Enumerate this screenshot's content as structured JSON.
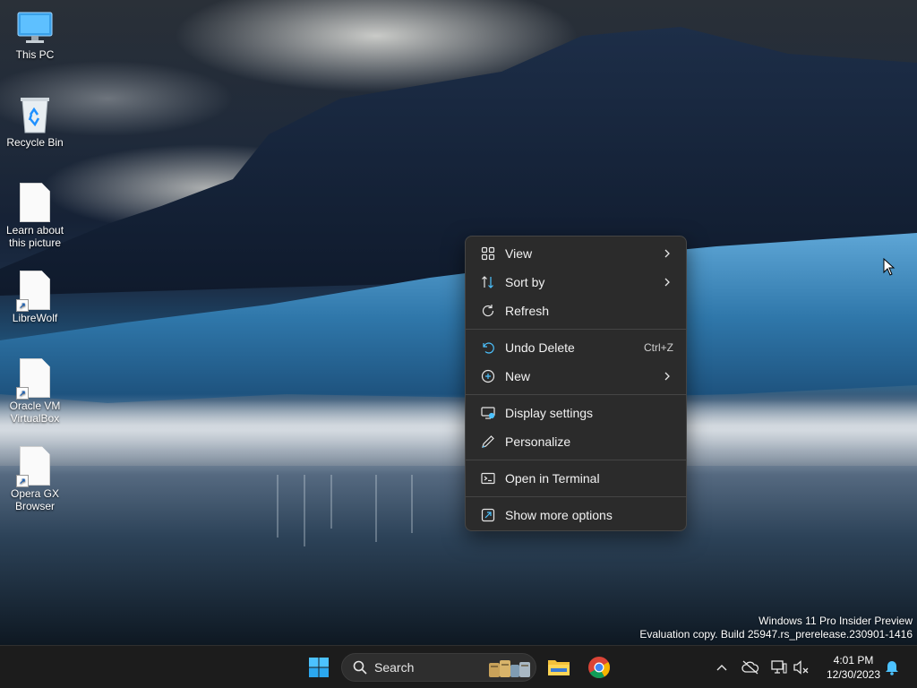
{
  "desktop": {
    "icons": [
      {
        "label": "This PC",
        "icon": "monitor-icon"
      },
      {
        "label": "Recycle Bin",
        "icon": "recycle-bin-icon"
      },
      {
        "label": "Learn about this picture",
        "icon": "file-icon"
      },
      {
        "label": "LibreWolf",
        "icon": "file-shortcut-icon"
      },
      {
        "label": "Oracle VM VirtualBox",
        "icon": "file-shortcut-icon"
      },
      {
        "label": "Opera GX Browser",
        "icon": "file-shortcut-icon"
      }
    ],
    "watermark": {
      "line1": "Windows 11 Pro Insider Preview",
      "line2": "Evaluation copy. Build 25947.rs_prerelease.230901-1416"
    }
  },
  "context_menu": {
    "items": [
      {
        "label": "View",
        "icon": "view-grid-icon",
        "submenu": true
      },
      {
        "label": "Sort by",
        "icon": "sort-icon",
        "submenu": true
      },
      {
        "label": "Refresh",
        "icon": "refresh-icon"
      },
      {
        "label": "Undo Delete",
        "icon": "undo-icon",
        "shortcut": "Ctrl+Z"
      },
      {
        "label": "New",
        "icon": "new-plus-icon",
        "submenu": true
      },
      {
        "label": "Display settings",
        "icon": "display-settings-icon"
      },
      {
        "label": "Personalize",
        "icon": "pen-icon"
      },
      {
        "label": "Open in Terminal",
        "icon": "terminal-icon"
      },
      {
        "label": "Show more options",
        "icon": "show-more-icon"
      }
    ]
  },
  "taskbar": {
    "search_placeholder": "Search",
    "clock": {
      "time": "4:01 PM",
      "date": "12/30/2023"
    }
  },
  "colors": {
    "menu_bg": "#2b2b2b",
    "taskbar_bg": "#1c1c1c",
    "accent": "#4cc2ff"
  }
}
